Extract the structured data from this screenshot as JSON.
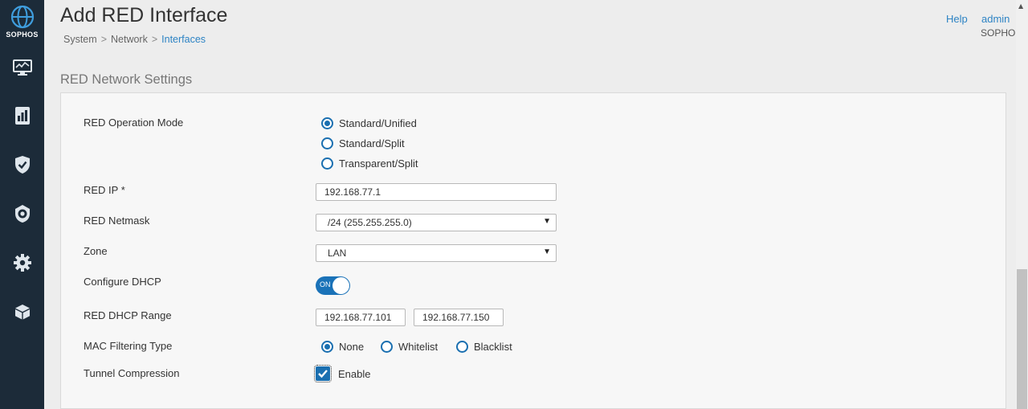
{
  "brand": {
    "logo_text": "SOPHOS",
    "accent": "#1a6fb0",
    "sidebar_bg": "#1c2b39"
  },
  "sidebar": {
    "icons": [
      "monitor-icon",
      "report-icon",
      "shield-icon",
      "protection-icon",
      "gear-icon",
      "package-icon"
    ]
  },
  "header": {
    "title": "Add RED Interface",
    "breadcrumb": [
      "System",
      "Network",
      "Interfaces"
    ],
    "help": "Help",
    "admin": "admin",
    "org": "SOPHOS"
  },
  "section_title": "RED Network Settings",
  "form": {
    "operation_mode": {
      "label": "RED Operation Mode",
      "options": [
        "Standard/Unified",
        "Standard/Split",
        "Transparent/Split"
      ],
      "selected": 0
    },
    "red_ip": {
      "label": "RED IP *",
      "value": "192.168.77.1"
    },
    "netmask": {
      "label": "RED Netmask",
      "value": "/24 (255.255.255.0)"
    },
    "zone": {
      "label": "Zone",
      "value": "LAN"
    },
    "dhcp": {
      "label": "Configure DHCP",
      "state": "ON"
    },
    "dhcp_range": {
      "label": "RED DHCP Range",
      "start": "192.168.77.101",
      "end": "192.168.77.150"
    },
    "mac_filter": {
      "label": "MAC Filtering Type",
      "options": [
        "None",
        "Whitelist",
        "Blacklist"
      ],
      "selected": 0
    },
    "compression": {
      "label": "Tunnel Compression",
      "option": "Enable",
      "checked": true
    }
  }
}
